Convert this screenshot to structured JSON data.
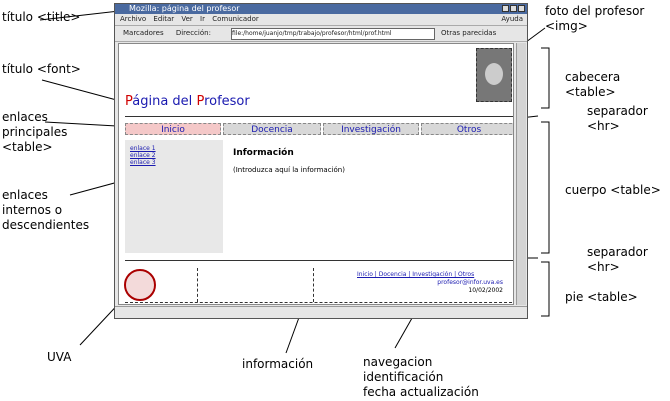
{
  "labels": {
    "titulo_title": "título <title>",
    "titulo_font": "título <font>",
    "enlaces_principales": "enlaces\nprincipales\n<table>",
    "enlaces_internos": "enlaces\ninternos o\ndescendientes",
    "uva": "UVA",
    "informacion": "información",
    "pie_notes": "navegacion\nidentificación\nfecha actualización",
    "foto": "foto del profesor\n<img>",
    "cabecera": "cabecera <table>",
    "separador1": "separador\n<hr>",
    "cuerpo": "cuerpo <table>",
    "separador2": "separador\n<hr>",
    "pie": "pie <table>"
  },
  "browser": {
    "title": "Mozilla: página del profesor",
    "menu": [
      "Archivo",
      "Editar",
      "Ver",
      "Ir",
      "Comunicador"
    ],
    "menu_right": "Ayuda",
    "toolbar": {
      "bookmarks": "Marcadores",
      "address_label": "Dirección:",
      "url": "file:/home/juanjo/tmp/trabajo/profesor/html/prof.html",
      "related": "Otras parecidas"
    }
  },
  "page": {
    "title_parts": [
      "P",
      "ágina del ",
      "P",
      "rofesor"
    ],
    "nav": [
      "Inicio",
      "Docencia",
      "Investigación",
      "Otros"
    ],
    "side_links": [
      "enlace 1",
      "enlace 2",
      "enlace 3"
    ],
    "info_heading": "Información",
    "info_text": "(Introduzca aquí la información)",
    "footer_nav": "Inicio | Docencia | Investigación | Otros",
    "footer_id": "profesor@infor.uva.es",
    "footer_date": "10/02/2002"
  }
}
